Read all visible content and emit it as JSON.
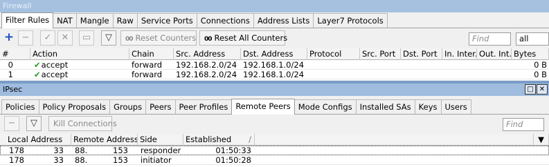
{
  "firewall": {
    "title": "Firewall",
    "tabs": [
      "Filter Rules",
      "NAT",
      "Mangle",
      "Raw",
      "Service Ports",
      "Connections",
      "Address Lists",
      "Layer7 Protocols"
    ],
    "toolbar": {
      "reset_counters": "Reset Counters",
      "reset_all_counters": "Reset All Counters",
      "counter_glyph": "00",
      "find_placeholder": "Find",
      "filter_select": "all"
    },
    "columns": [
      "#",
      "Action",
      "Chain",
      "Src. Address",
      "Dst. Address",
      "Protocol",
      "Src. Port",
      "Dst. Port",
      "In. Inter...",
      "Out. Int...",
      "Bytes"
    ],
    "rows": [
      {
        "num": "0",
        "action": "accept",
        "chain": "forward",
        "src": "192.168.2.0/24",
        "dst": "192.168.1.0/24",
        "bytes": "0 B"
      },
      {
        "num": "1",
        "action": "accept",
        "chain": "forward",
        "src": "192.168.2.0/24",
        "dst": "192.168.1.0/24",
        "bytes": "0 B"
      }
    ]
  },
  "ipsec": {
    "title": "IPsec",
    "tabs": [
      "Policies",
      "Policy Proposals",
      "Groups",
      "Peers",
      "Peer Profiles",
      "Remote Peers",
      "Mode Configs",
      "Installed SAs",
      "Keys",
      "Users"
    ],
    "active_tab": "Remote Peers",
    "toolbar": {
      "kill_connections": "Kill Connections",
      "find_placeholder": "Find"
    },
    "columns": [
      "Local Address",
      "Remote Address",
      "Side",
      "Established"
    ],
    "rows": [
      {
        "local_a": "178",
        "local_b": "33",
        "remote_a": "88.",
        "remote_b": "153",
        "side": "responder",
        "established": "01:50:33"
      },
      {
        "local_a": "178",
        "local_b": "33",
        "remote_a": "88.",
        "remote_b": "153",
        "side": "initiator",
        "established": "01:50:28"
      }
    ]
  }
}
